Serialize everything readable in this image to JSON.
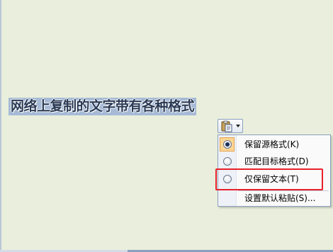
{
  "document": {
    "selected_text": "网络上复制的文字带有各种格式"
  },
  "paste_options": {
    "button_icon": "clipboard-paste-icon",
    "dropdown_icon": "dropdown-arrow-icon",
    "items": [
      {
        "label": "保留源格式(K)",
        "selected": true
      },
      {
        "label": "匹配目标格式(D)",
        "selected": false
      },
      {
        "label": "仅保留文本(T)",
        "selected": false,
        "highlighted": true
      }
    ],
    "default_item": {
      "label": "设置默认粘贴(S)..."
    }
  },
  "colors": {
    "background": "#e9efdc",
    "selection": "#a6bad6",
    "highlight_border": "#e8212b",
    "checked_frame": "#fcd695"
  }
}
